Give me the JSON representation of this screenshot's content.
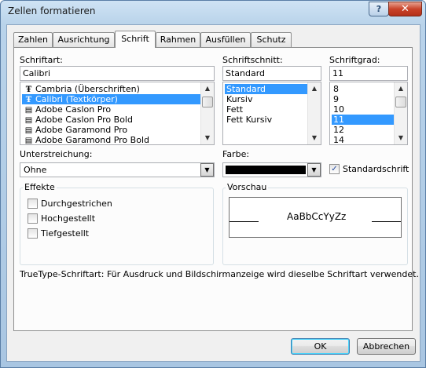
{
  "window": {
    "title": "Zellen formatieren",
    "help_label": "?",
    "close_label": "✕"
  },
  "tabs": [
    "Zahlen",
    "Ausrichtung",
    "Schrift",
    "Rahmen",
    "Ausfüllen",
    "Schutz"
  ],
  "active_tab": "Schrift",
  "font": {
    "label": "Schriftart:",
    "value": "Calibri",
    "items": [
      {
        "name": "Cambria (Überschriften)",
        "icon": "truetype-icon"
      },
      {
        "name": "Calibri (Textkörper)",
        "icon": "truetype-icon",
        "selected": true
      },
      {
        "name": "Adobe Caslon Pro",
        "icon": "opentype-icon"
      },
      {
        "name": "Adobe Caslon Pro Bold",
        "icon": "opentype-icon"
      },
      {
        "name": "Adobe Garamond Pro",
        "icon": "opentype-icon"
      },
      {
        "name": "Adobe Garamond Pro Bold",
        "icon": "opentype-icon"
      }
    ]
  },
  "style": {
    "label": "Schriftschnitt:",
    "value": "Standard",
    "items": [
      "Standard",
      "Kursiv",
      "Fett",
      "Fett Kursiv"
    ],
    "selected": "Standard"
  },
  "size": {
    "label": "Schriftgrad:",
    "value": "11",
    "items": [
      "8",
      "9",
      "10",
      "11",
      "12",
      "14"
    ],
    "selected": "11"
  },
  "underline": {
    "label": "Unterstreichung:",
    "value": "Ohne"
  },
  "color": {
    "label": "Farbe:",
    "value": "#000000",
    "standard_font_label": "Standardschrift",
    "standard_font_checked": true
  },
  "effects": {
    "title": "Effekte",
    "items": [
      {
        "label": "Durchgestrichen",
        "checked": false
      },
      {
        "label": "Hochgestellt",
        "checked": false
      },
      {
        "label": "Tiefgestellt",
        "checked": false
      }
    ]
  },
  "preview": {
    "title": "Vorschau",
    "sample": "AaBbCcYyZz"
  },
  "info_text": "TrueType-Schriftart: Für Ausdruck und Bildschirmanzeige wird dieselbe Schriftart verwendet.",
  "buttons": {
    "ok": "OK",
    "cancel": "Abbrechen"
  }
}
